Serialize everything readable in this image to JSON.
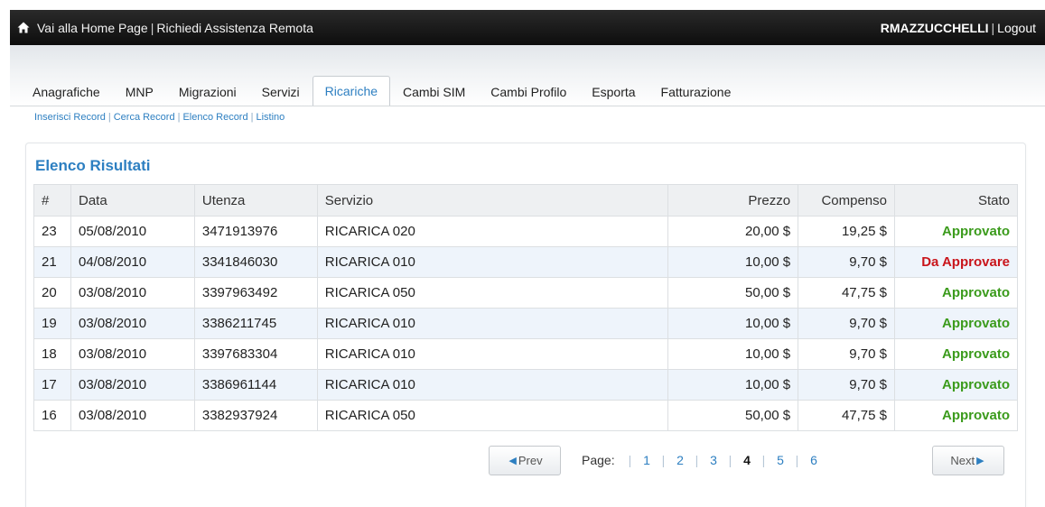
{
  "topbar": {
    "home_link": "Vai alla Home Page",
    "assist_link": "Richiedi Assistenza Remota",
    "username": "RMAZZUCCHELLI",
    "logout": "Logout",
    "separator": "|"
  },
  "tabs": [
    "Anagrafiche",
    "MNP",
    "Migrazioni",
    "Servizi",
    "Ricariche",
    "Cambi SIM",
    "Cambi Profilo",
    "Esporta",
    "Fatturazione"
  ],
  "active_tab": "Ricariche",
  "subnav": [
    "Inserisci Record",
    "Cerca Record",
    "Elenco Record",
    "Listino"
  ],
  "panel": {
    "title": "Elenco Risultati",
    "columns": [
      "#",
      "Data",
      "Utenza",
      "Servizio",
      "Prezzo",
      "Compenso",
      "Stato"
    ],
    "rows": [
      {
        "id": "23",
        "data": "05/08/2010",
        "utenza": "3471913976",
        "servizio": "RICARICA 020",
        "prezzo": "20,00 $",
        "compenso": "19,25 $",
        "stato": "Approvato"
      },
      {
        "id": "21",
        "data": "04/08/2010",
        "utenza": "3341846030",
        "servizio": "RICARICA 010",
        "prezzo": "10,00 $",
        "compenso": "9,70 $",
        "stato": "Da Approvare"
      },
      {
        "id": "20",
        "data": "03/08/2010",
        "utenza": "3397963492",
        "servizio": "RICARICA 050",
        "prezzo": "50,00 $",
        "compenso": "47,75 $",
        "stato": "Approvato"
      },
      {
        "id": "19",
        "data": "03/08/2010",
        "utenza": "3386211745",
        "servizio": "RICARICA 010",
        "prezzo": "10,00 $",
        "compenso": "9,70 $",
        "stato": "Approvato"
      },
      {
        "id": "18",
        "data": "03/08/2010",
        "utenza": "3397683304",
        "servizio": "RICARICA 010",
        "prezzo": "10,00 $",
        "compenso": "9,70 $",
        "stato": "Approvato"
      },
      {
        "id": "17",
        "data": "03/08/2010",
        "utenza": "3386961144",
        "servizio": "RICARICA 010",
        "prezzo": "10,00 $",
        "compenso": "9,70 $",
        "stato": "Approvato"
      },
      {
        "id": "16",
        "data": "03/08/2010",
        "utenza": "3382937924",
        "servizio": "RICARICA 050",
        "prezzo": "50,00 $",
        "compenso": "47,75 $",
        "stato": "Approvato"
      }
    ]
  },
  "pagination": {
    "prev": "Prev",
    "next": "Next",
    "label": "Page:",
    "pages": [
      "1",
      "2",
      "3",
      "4",
      "5",
      "6"
    ],
    "current": "4"
  },
  "colors": {
    "accent": "#2d7fc1",
    "approved": "#3b9b1c",
    "pending": "#c9151b",
    "topbar": "#1a1a1a"
  },
  "icons": {
    "home": "home-icon",
    "prev_arrow": "arrow-left-icon",
    "next_arrow": "arrow-right-icon"
  }
}
